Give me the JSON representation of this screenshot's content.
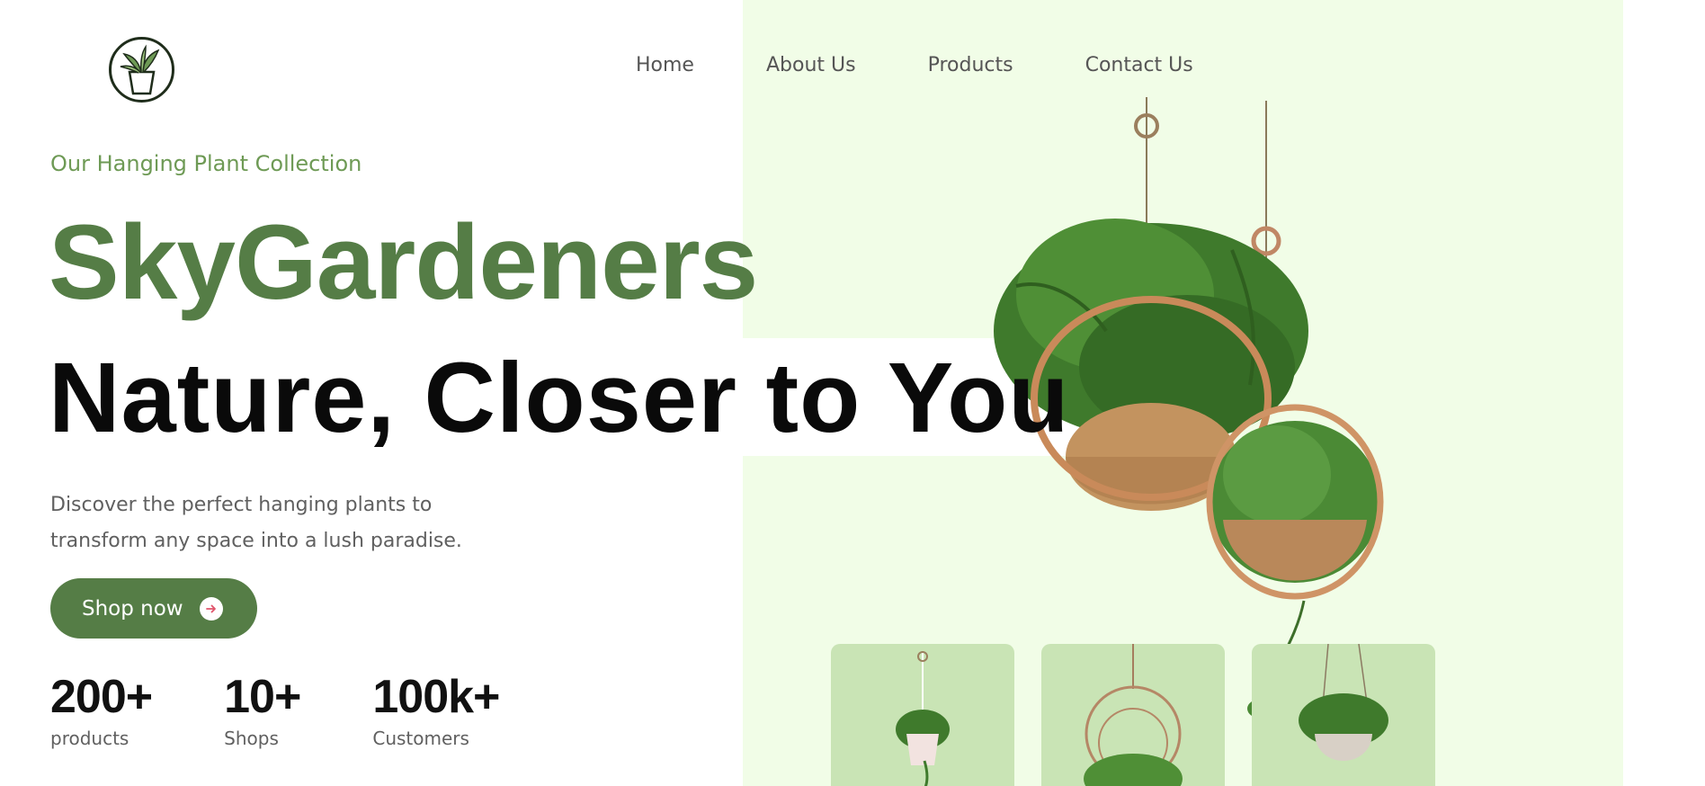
{
  "brand": {
    "logo_icon": "potted-plant-logo-icon",
    "name": "SkyGardeners",
    "eyebrow": "Our Hanging Plant Collection"
  },
  "nav": {
    "items": [
      {
        "label": "Home"
      },
      {
        "label": "About Us"
      },
      {
        "label": "Products"
      },
      {
        "label": "Contact Us"
      }
    ]
  },
  "hero": {
    "tagline": "Nature, Closer to You",
    "description_line1": "Discover the perfect hanging plants to",
    "description_line2": "transform any space into a lush paradise.",
    "cta_label": "Shop now",
    "cta_icon": "arrow-right-icon"
  },
  "stats": [
    {
      "value": "200+",
      "label": "products"
    },
    {
      "value": "10+",
      "label": "Shops"
    },
    {
      "value": "100k+",
      "label": "Customers"
    }
  ],
  "colors": {
    "accent": "#557d46",
    "panel": "#f1fde7",
    "card": "#c9e4b5"
  }
}
